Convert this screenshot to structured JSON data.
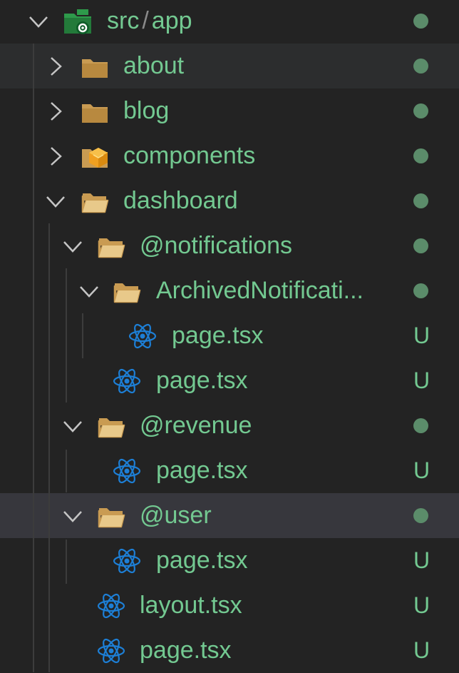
{
  "explorer": {
    "root": {
      "name": "src",
      "separator": "/",
      "sub": "app",
      "icon": "src-folder-gear-icon",
      "expanded": true,
      "badge": "dot"
    },
    "items": [
      {
        "label": "about",
        "type": "folder",
        "icon": "folder-icon",
        "expanded": false,
        "depth": 1,
        "badge": "dot"
      },
      {
        "label": "blog",
        "type": "folder",
        "icon": "folder-icon",
        "expanded": false,
        "depth": 1,
        "badge": "dot"
      },
      {
        "label": "components",
        "type": "folder",
        "icon": "components-folder-icon",
        "expanded": false,
        "depth": 1,
        "badge": "dot"
      },
      {
        "label": "dashboard",
        "type": "folder",
        "icon": "folder-open-icon",
        "expanded": true,
        "depth": 1,
        "badge": "dot"
      },
      {
        "label": "@notifications",
        "type": "folder",
        "icon": "folder-open-icon",
        "expanded": true,
        "depth": 2,
        "badge": "dot"
      },
      {
        "label": "ArchivedNotificati...",
        "type": "folder",
        "icon": "folder-open-icon",
        "expanded": true,
        "depth": 3,
        "badge": "dot"
      },
      {
        "label": "page.tsx",
        "type": "file",
        "icon": "react-icon",
        "depth": 4,
        "badge": "U"
      },
      {
        "label": "page.tsx",
        "type": "file",
        "icon": "react-icon",
        "depth": 3,
        "badge": "U"
      },
      {
        "label": "@revenue",
        "type": "folder",
        "icon": "folder-open-icon",
        "expanded": true,
        "depth": 2,
        "badge": "dot"
      },
      {
        "label": "page.tsx",
        "type": "file",
        "icon": "react-icon",
        "depth": 3,
        "badge": "U"
      },
      {
        "label": "@user",
        "type": "folder",
        "icon": "folder-open-icon",
        "expanded": true,
        "depth": 2,
        "badge": "dot"
      },
      {
        "label": "page.tsx",
        "type": "file",
        "icon": "react-icon",
        "depth": 3,
        "badge": "U"
      },
      {
        "label": "layout.tsx",
        "type": "file",
        "icon": "react-icon",
        "depth": 2,
        "badge": "U"
      },
      {
        "label": "page.tsx",
        "type": "file",
        "icon": "react-icon",
        "depth": 2,
        "badge": "U"
      }
    ]
  },
  "colors": {
    "background": "#232323",
    "untracked_text": "#73c991",
    "badge_dot": "#5b8c6a",
    "folder": "#c99b52",
    "react": "#1d7fd6",
    "components_icon": "#f0a020",
    "src_folder": "#2e9a4b"
  }
}
